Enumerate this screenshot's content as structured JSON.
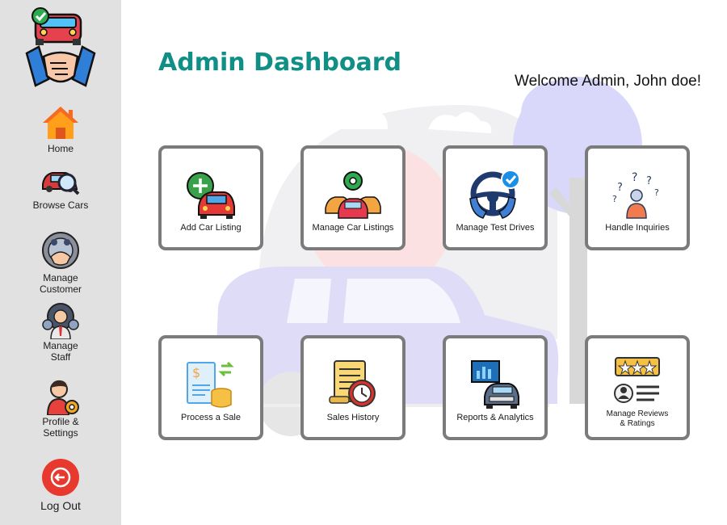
{
  "sidebar": {
    "items": [
      {
        "label": "Home",
        "icon": "home-icon"
      },
      {
        "label": "Browse Cars",
        "icon": "car-search-icon"
      },
      {
        "label": "Manage\nCustomer",
        "icon": "customer-handshake-icon"
      },
      {
        "label": "Manage\nStaff",
        "icon": "staff-icon"
      },
      {
        "label": "Profile &\nSettings",
        "icon": "profile-gear-icon"
      },
      {
        "label": "Log Out",
        "icon": "logout-icon"
      }
    ]
  },
  "header": {
    "title": "Admin Dashboard",
    "welcome": "Welcome Admin, John doe!"
  },
  "tiles": [
    {
      "label": "Add Car Listing",
      "icon": "add-car-icon"
    },
    {
      "label": "Manage Car Listings",
      "icon": "manage-cars-icon"
    },
    {
      "label": "Manage Test Drives",
      "icon": "steering-wheel-icon"
    },
    {
      "label": "Handle Inquiries",
      "icon": "inquiry-icon"
    },
    {
      "label": "Process a Sale",
      "icon": "sale-icon"
    },
    {
      "label": "Sales History",
      "icon": "history-icon"
    },
    {
      "label": "Reports & Analytics",
      "icon": "analytics-icon"
    },
    {
      "label": "Manage Reviews\n& Ratings",
      "icon": "reviews-icon"
    }
  ],
  "colors": {
    "title": "#108f86",
    "sidebar_bg": "#e1e1e1",
    "tile_border": "#7b7b7b",
    "logout": "#e8392f"
  }
}
